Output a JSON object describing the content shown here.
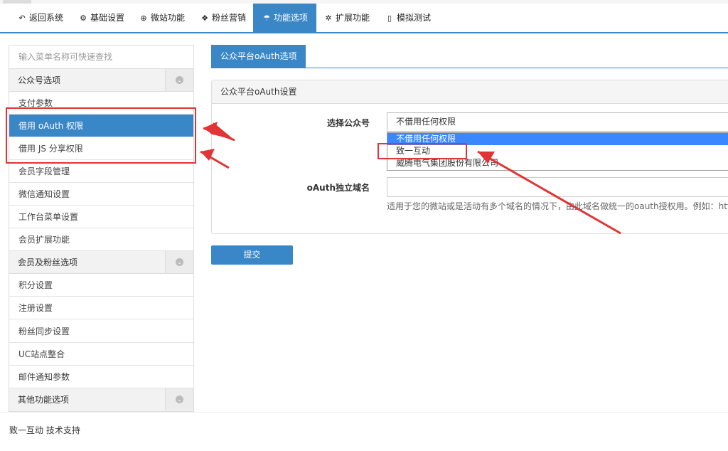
{
  "nav": {
    "items": [
      {
        "label": "返回系统",
        "icon": "back-arrow-icon"
      },
      {
        "label": "基础设置",
        "icon": "gear-icon"
      },
      {
        "label": "微站功能",
        "icon": "lifebuoy-icon"
      },
      {
        "label": "粉丝营销",
        "icon": "gift-icon"
      },
      {
        "label": "功能选项",
        "icon": "umbrella-icon"
      },
      {
        "label": "扩展功能",
        "icon": "cogs-icon"
      },
      {
        "label": "模拟测试",
        "icon": "mobile-icon"
      }
    ],
    "active_index": 4
  },
  "sidebar": {
    "search_placeholder": "输入菜单名称可快速查找",
    "groups": [
      "公众号选项",
      "会员及粉丝选项",
      "其他功能选项"
    ],
    "items": [
      "支付参数",
      "借用 oAuth 权限",
      "借用 JS 分享权限",
      "会员字段管理",
      "微信通知设置",
      "工作台菜单设置",
      "会员扩展功能",
      "积分设置",
      "注册设置",
      "粉丝同步设置",
      "UC站点整合",
      "邮件通知参数"
    ],
    "active_item_index": 1
  },
  "main": {
    "tab_label": "公众平台oAuth选项",
    "panel_title": "公众平台oAuth设置",
    "field_account_label": "选择公众号",
    "select_value": "不借用任何权限",
    "options": [
      "不借用任何权限",
      "致一互动",
      "威腾电气集团股份有限公司"
    ],
    "highlighted_option_index": 0,
    "field_domain_label": "oAuth独立域名",
    "domain_value": "",
    "domain_help": "适用于您的微站或是活动有多个域名的情况下，由此域名做统一的oauth授权用。例如：http://",
    "submit_label": "提交"
  },
  "footer": {
    "text": "致一互动 技术支持"
  },
  "colors": {
    "accent": "#3a87c8",
    "annotation": "#e23434"
  }
}
